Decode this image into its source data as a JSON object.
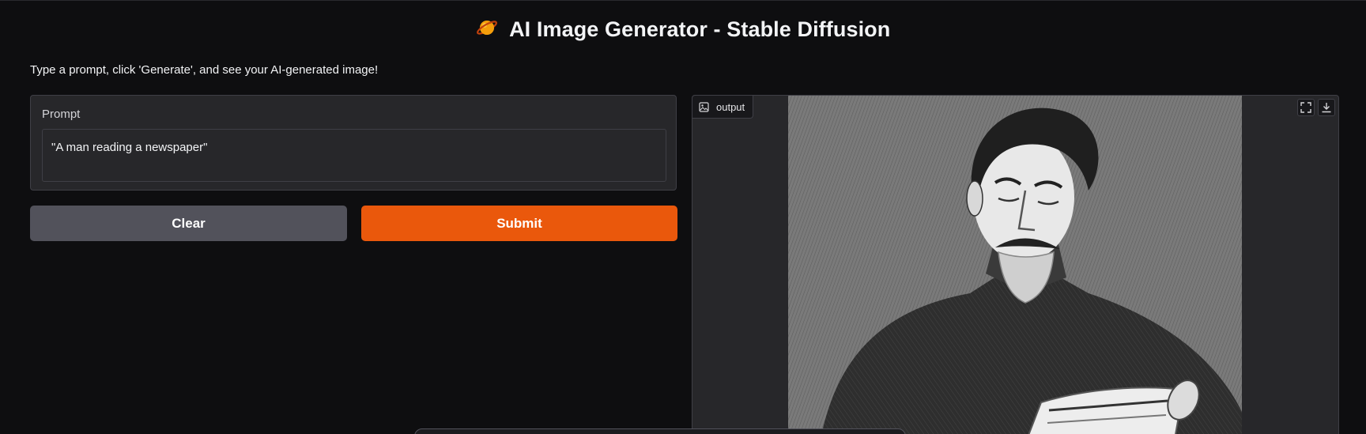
{
  "header": {
    "title": "AI Image Generator - Stable Diffusion",
    "icon": "planet-emoji-icon"
  },
  "description": "Type a prompt, click 'Generate', and see your AI-generated image!",
  "prompt": {
    "label": "Prompt",
    "value": "\"A man reading a newspaper\""
  },
  "buttons": {
    "clear_label": "Clear",
    "submit_label": "Submit"
  },
  "output": {
    "tab_label": "output",
    "tab_icon": "image-icon",
    "image_alt": "Black and white illustration of a man reading a newspaper",
    "tools": [
      "fullscreen-icon",
      "download-icon"
    ]
  },
  "colors": {
    "background": "#0e0e10",
    "panel": "#27272a",
    "accent": "#ea580c",
    "secondary_button": "#52525b"
  }
}
